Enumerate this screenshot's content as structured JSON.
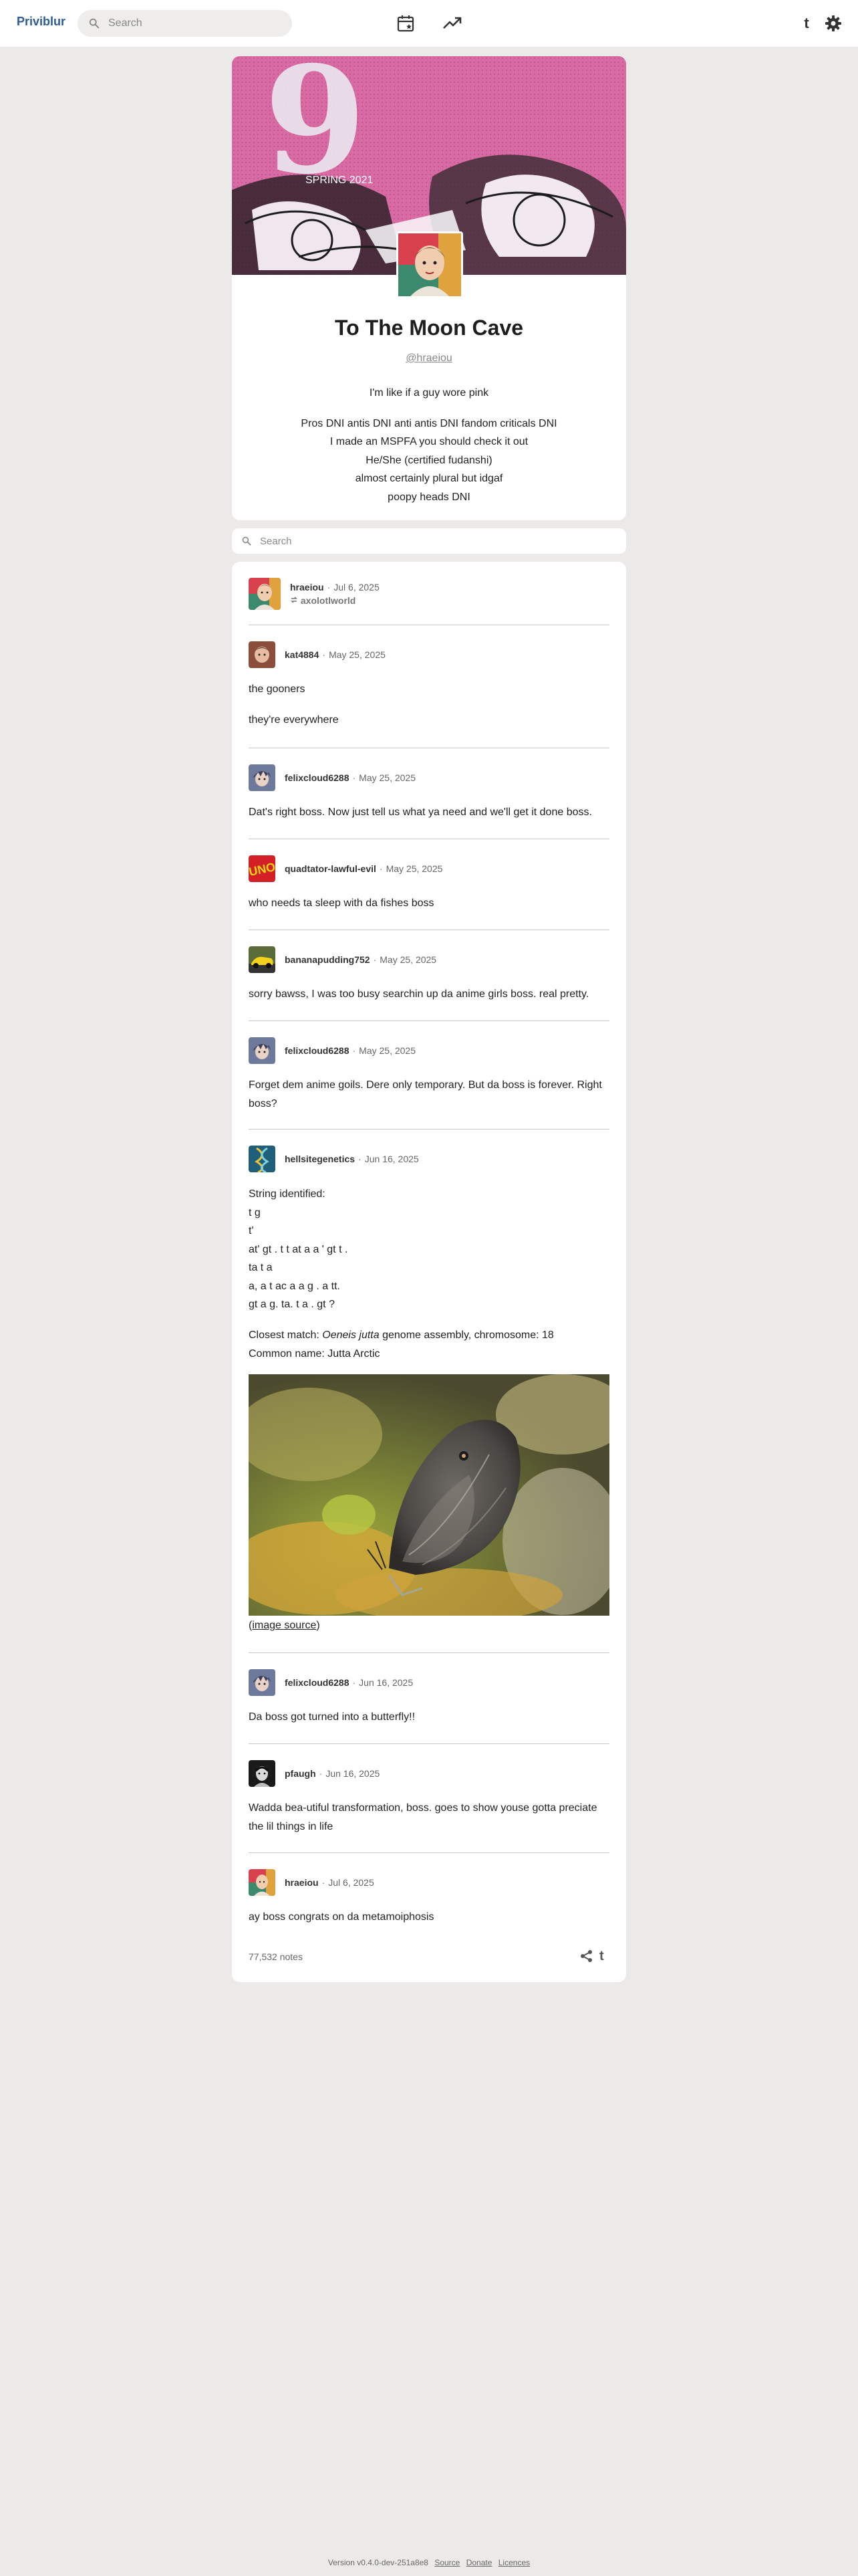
{
  "app": {
    "name": "Priviblur"
  },
  "topbar": {
    "search_placeholder": "Search",
    "icons": [
      "search-icon",
      "calendar-icon",
      "trending-icon",
      "tumblr-icon",
      "gear-icon"
    ]
  },
  "blog": {
    "title": "To The Moon Cave",
    "handle": "@hraeiou",
    "bio_intro": "I'm like if a guy wore pink",
    "bio_lines": [
      "Pros DNI antis DNI anti antis DNI fandom criticals DNI",
      "I made an MSPFA you should check it out",
      "He/She (certified fudanshi)",
      "almost certainly plural but idgaf",
      "poopy heads DNI"
    ],
    "banner_number": "9",
    "banner_color": "#d86aa4"
  },
  "blog_search": {
    "placeholder": "Search"
  },
  "post": {
    "author": "hraeiou",
    "date": "Jul 6, 2025",
    "reblogged_from": "axolotlworld",
    "thread": [
      {
        "user": "kat4884",
        "date": "May 25, 2025",
        "body": [
          "the gooners",
          "they're everywhere"
        ]
      },
      {
        "user": "felixcloud6288",
        "date": "May 25, 2025",
        "body": [
          "Dat's right boss. Now just tell us what ya need and we'll get it done boss."
        ]
      },
      {
        "user": "quadtator-lawful-evil",
        "date": "May 25, 2025",
        "body": [
          "who needs ta sleep with da fishes boss"
        ]
      },
      {
        "user": "bananapudding752",
        "date": "May 25, 2025",
        "body": [
          "sorry bawss, I was too busy searchin up da anime girls boss. real pretty."
        ]
      },
      {
        "user": "felixcloud6288",
        "date": "May 25, 2025",
        "body": [
          "Forget dem anime goils. Dere only temporary. But da boss is forever. Right boss?"
        ]
      },
      {
        "user": "hellsitegenetics",
        "date": "Jun 16, 2025",
        "string_lines": [
          "String identified:",
          "t g",
          "t'",
          "at' gt . t t at a a ' gt t .",
          "ta t a",
          "a, a t ac a a g . a tt.",
          "gt a g. ta. t a . gt ?"
        ],
        "match_prefix": "Closest match: ",
        "match_species": "Oeneis jutta",
        "match_suffix": " genome assembly, chromosome: 18",
        "common_name": "Common name: Jutta Arctic",
        "image_source_label": "image source"
      },
      {
        "user": "felixcloud6288",
        "date": "Jun 16, 2025",
        "body": [
          "Da boss got turned into a butterfly!!"
        ]
      },
      {
        "user": "pfaugh",
        "date": "Jun 16, 2025",
        "body": [
          "Wadda bea-utiful transformation, boss. goes to show youse gotta preciate the lil things in life"
        ]
      },
      {
        "user": "hraeiou",
        "date": "Jul 6, 2025",
        "body": [
          "ay boss congrats on da metamoiphosis"
        ]
      }
    ],
    "notes": "77,532 notes"
  },
  "footer": {
    "version": "Version v0.4.0-dev-251a8e8",
    "links": [
      "Source",
      "Donate",
      "Licences"
    ]
  }
}
